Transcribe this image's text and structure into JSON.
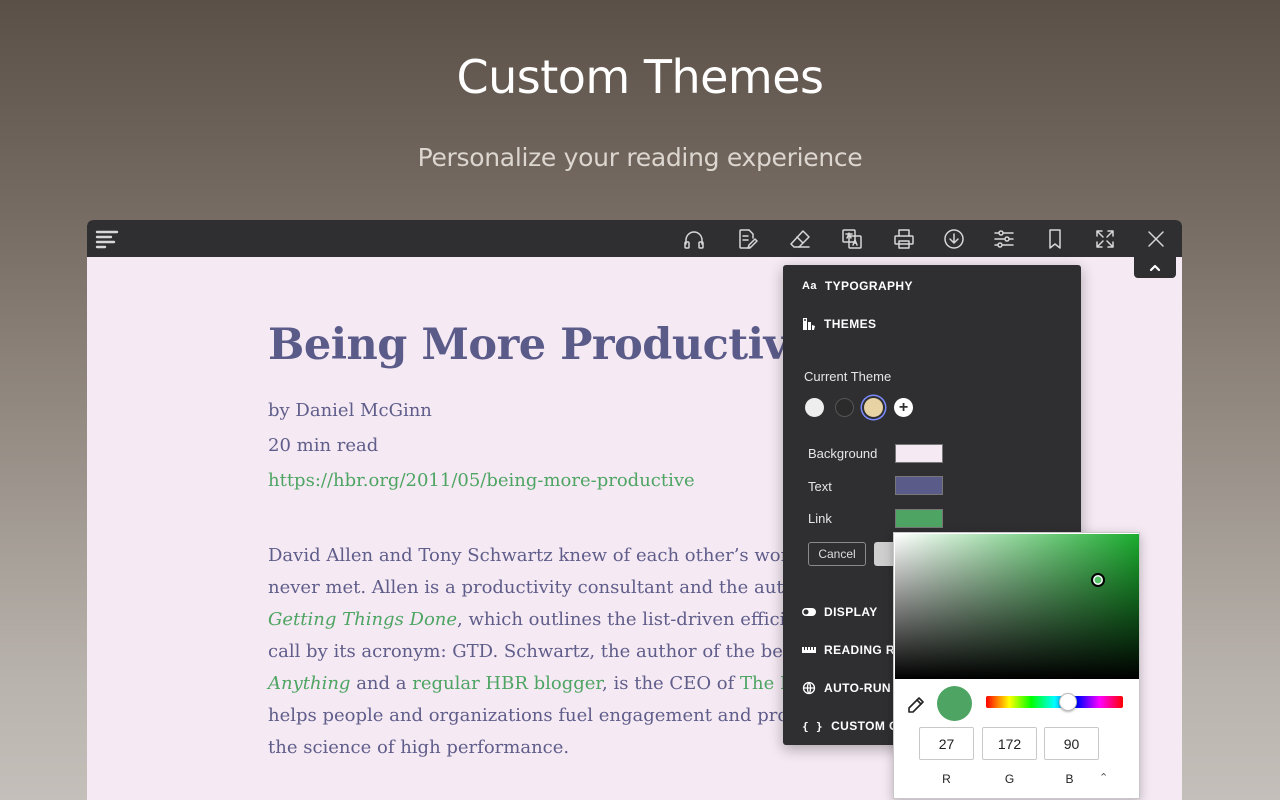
{
  "hero": {
    "title": "Custom Themes",
    "subtitle": "Personalize your reading experience"
  },
  "toolbar": {
    "icons": [
      "menu-icon",
      "headphones-icon",
      "edit-icon",
      "eraser-icon",
      "translate-icon",
      "print-icon",
      "download-icon",
      "sliders-icon",
      "bookmark-icon",
      "fullscreen-icon",
      "close-icon"
    ]
  },
  "article": {
    "title": "Being More Productive",
    "author": "by Daniel McGinn",
    "read_time": "20 min read",
    "url": "https://hbr.org/2011/05/being-more-productive",
    "lines": {
      "l1": "David Allen and Tony Schwartz knew of each other’s wor",
      "l2": "never met. Allen is a productivity consultant and the aut",
      "l3_link": "Getting Things Done",
      "l3_rest": ", which outlines the list-driven efficien",
      "l4": "call by its acronym: GTD. Schwartz, the author of the bes",
      "l5_link": "Anything",
      "l5_mid": " and a ",
      "l5_link2": "regular HBR blogger",
      "l5_mid2": ", is the CEO of ",
      "l5_link3": "The E",
      "l6": "helps people and organizations fuel engagement and pro",
      "l7": "the science of high performance."
    }
  },
  "panel": {
    "sections": {
      "typography": "TYPOGRAPHY",
      "typography_icon": "Aa",
      "themes": "THEMES",
      "display": "DISPLAY",
      "reading_ruler": "READING RU",
      "auto_run": "AUTO-RUN",
      "custom_css": "CUSTOM CS",
      "custom_css_icon": "{ }"
    },
    "current_theme_label": "Current Theme",
    "swatches": [
      {
        "name": "light",
        "color": "#eeeeee"
      },
      {
        "name": "dark",
        "color": "#2b2b2b"
      },
      {
        "name": "sepia",
        "color": "#e8d3a4",
        "selected": true
      }
    ],
    "add_theme_icon": "+",
    "rows": {
      "background_label": "Background",
      "background_color": "#f5e9f3",
      "text_label": "Text",
      "text_color": "#5b5b8a",
      "link_label": "Link",
      "link_color": "#4ea563"
    },
    "cancel_label": "Cancel"
  },
  "color_picker": {
    "preview_color": "#4ea563",
    "r": "27",
    "g": "172",
    "b": "90",
    "r_label": "R",
    "g_label": "G",
    "b_label": "B",
    "mode_toggle": "⌃⌄",
    "hue_fraction": 0.6,
    "saturation_fraction": 0.83,
    "value_fraction": 0.68
  }
}
